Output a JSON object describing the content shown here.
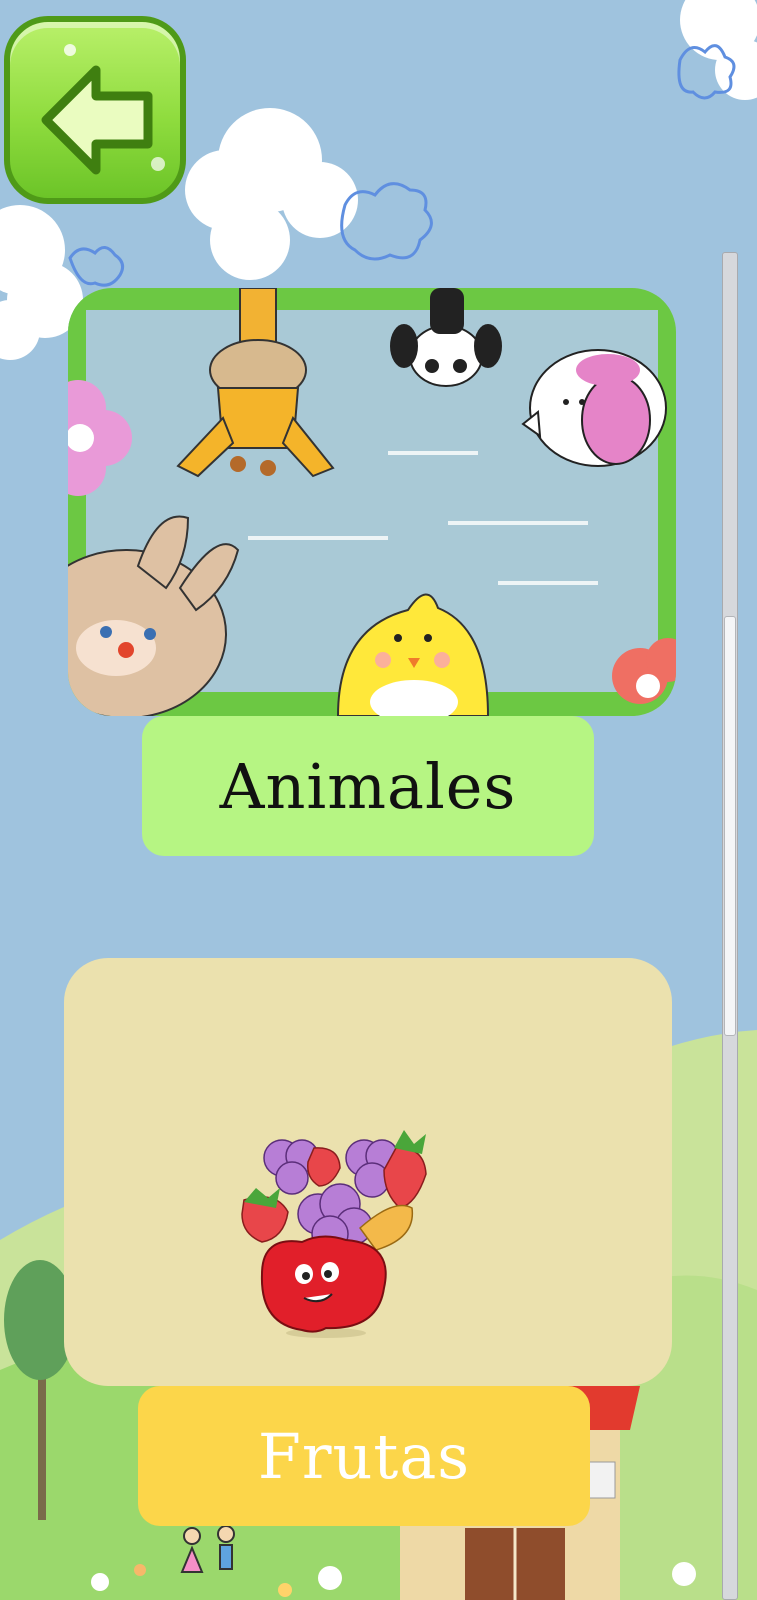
{
  "navigation": {
    "back_icon": "arrow-left-icon"
  },
  "categories": [
    {
      "label": "Animales",
      "image": "animals-illustration"
    },
    {
      "label": "Frutas",
      "image": "fruits-illustration"
    }
  ],
  "colors": {
    "sky": "#9fc3de",
    "animales_button": "#b6f583",
    "frutas_button": "#fcd64a",
    "frutas_card": "#ebe1ae",
    "back_button": "#8fdc3e"
  }
}
